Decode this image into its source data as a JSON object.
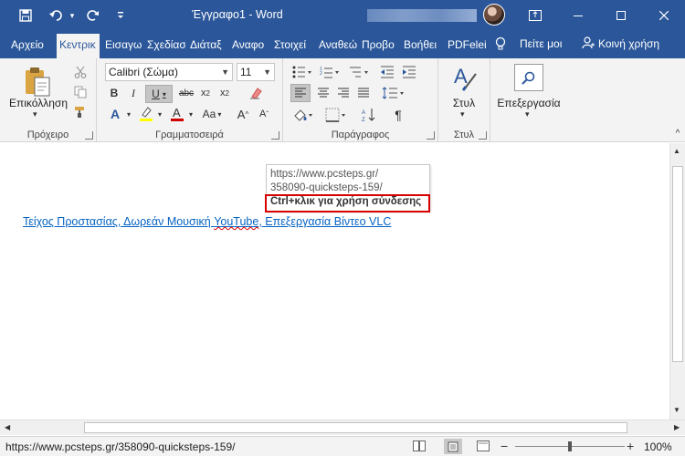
{
  "window": {
    "title": "Έγγραφο1 - Word",
    "blurred_user_name": ""
  },
  "qat": {
    "save_icon": "save-icon",
    "undo_icon": "undo-icon",
    "redo_icon": "redo-icon",
    "customize_icon": "customize-qat-icon"
  },
  "tabs": [
    {
      "label": "Αρχείο"
    },
    {
      "label": "Κεντρικ"
    },
    {
      "label": "Εισαγω"
    },
    {
      "label": "Σχεδίασ"
    },
    {
      "label": "Διάταξ"
    },
    {
      "label": "Αναφο"
    },
    {
      "label": "Στοιχεί"
    },
    {
      "label": "Αναθεώ"
    },
    {
      "label": "Προβο"
    },
    {
      "label": "Βοήθει"
    },
    {
      "label": "PDFelei"
    }
  ],
  "tellme": "Πείτε μοι",
  "share": "Κοινή χρήση",
  "ribbon": {
    "clipboard": {
      "label": "Πρόχειρο",
      "paste": "Επικόλληση"
    },
    "font": {
      "label": "Γραμματοσειρά",
      "font_name": "Calibri (Σώμα)",
      "font_size": "11"
    },
    "paragraph": {
      "label": "Παράγραφος"
    },
    "styles": {
      "label": "Στυλ",
      "styles_button": "Στυλ"
    },
    "editing": {
      "label": "Επεξεργασία"
    }
  },
  "document": {
    "link_part1": "Τείχος Προστασίας, Δωρεάν Μουσική ",
    "link_part2": "YouTube",
    "link_part3": ", Επεξεργασία Βίντεο VLC"
  },
  "tooltip": {
    "url_line1": "https://www.pcsteps.gr/",
    "url_line2": "358090-quicksteps-159/",
    "hint": "Ctrl+κλικ για χρήση σύνδεσης"
  },
  "statusbar": {
    "url": "https://www.pcsteps.gr/358090-quicksteps-159/",
    "zoom": "100%"
  }
}
